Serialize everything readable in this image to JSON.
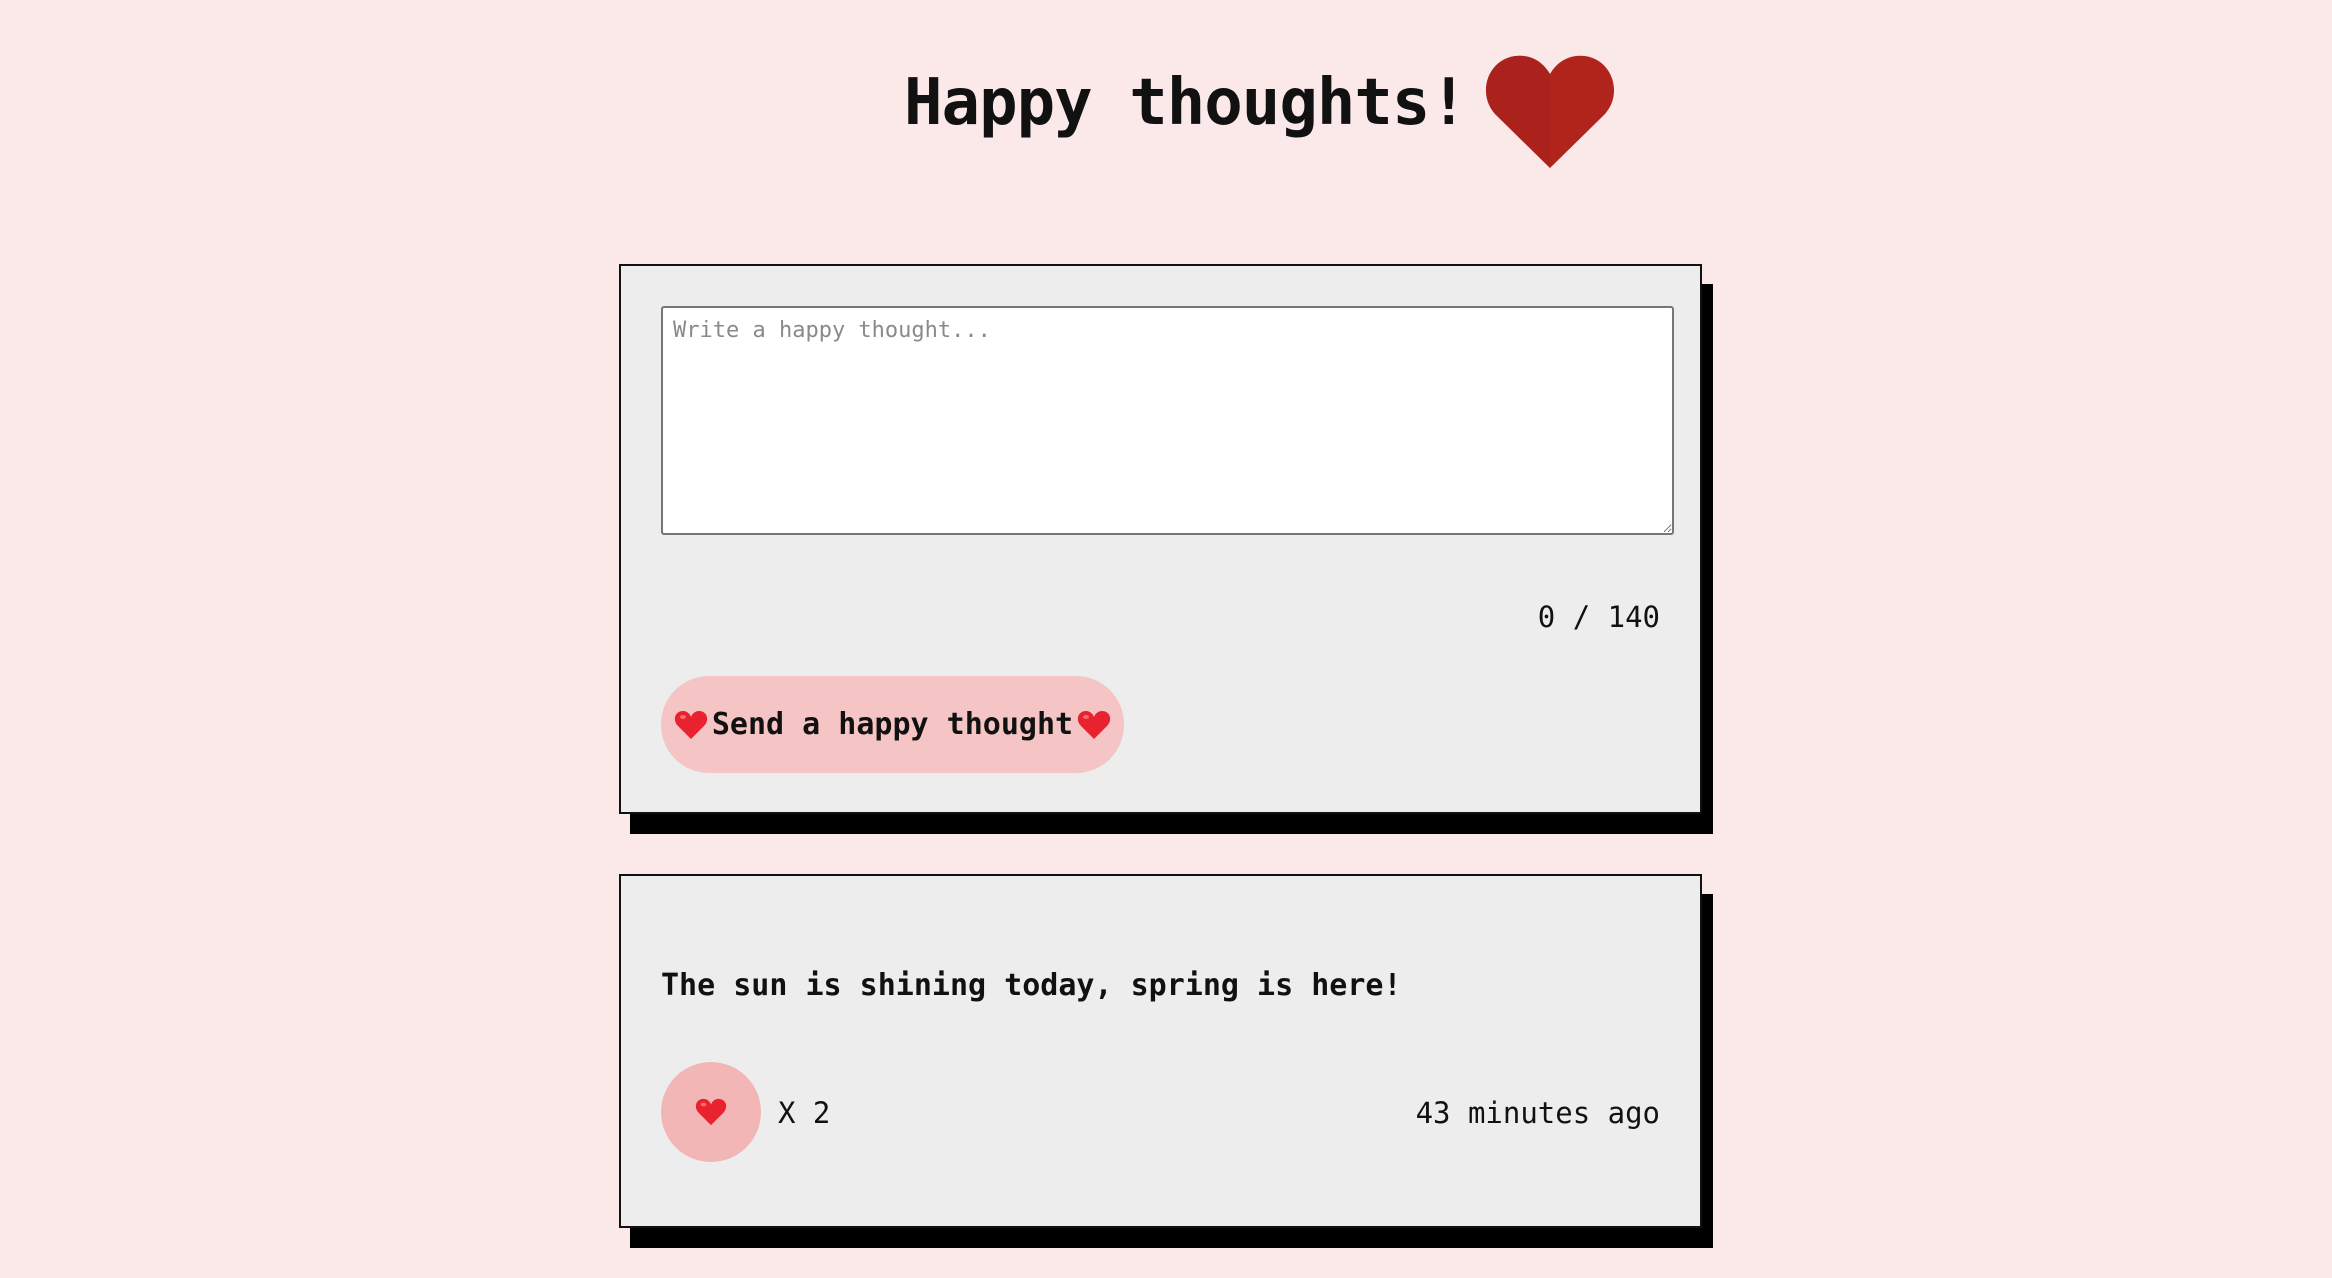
{
  "header": {
    "title": "Happy thoughts!",
    "heart_icon": "heart-icon",
    "heart_color": "#b0241c"
  },
  "form": {
    "placeholder": "Write a happy thought...",
    "value": "",
    "char_count": "0 / 140",
    "send_label": "Send a happy thought",
    "button_color": "#f5c5c5"
  },
  "thoughts": [
    {
      "message": "The sun is shining today, spring is here!",
      "likes_text": "X 2",
      "time_ago": "43 minutes ago",
      "like_button_color": "#f2b6b6"
    }
  ],
  "colors": {
    "background": "#fbe9e9",
    "card": "#ededed",
    "shadow": "#000000"
  }
}
